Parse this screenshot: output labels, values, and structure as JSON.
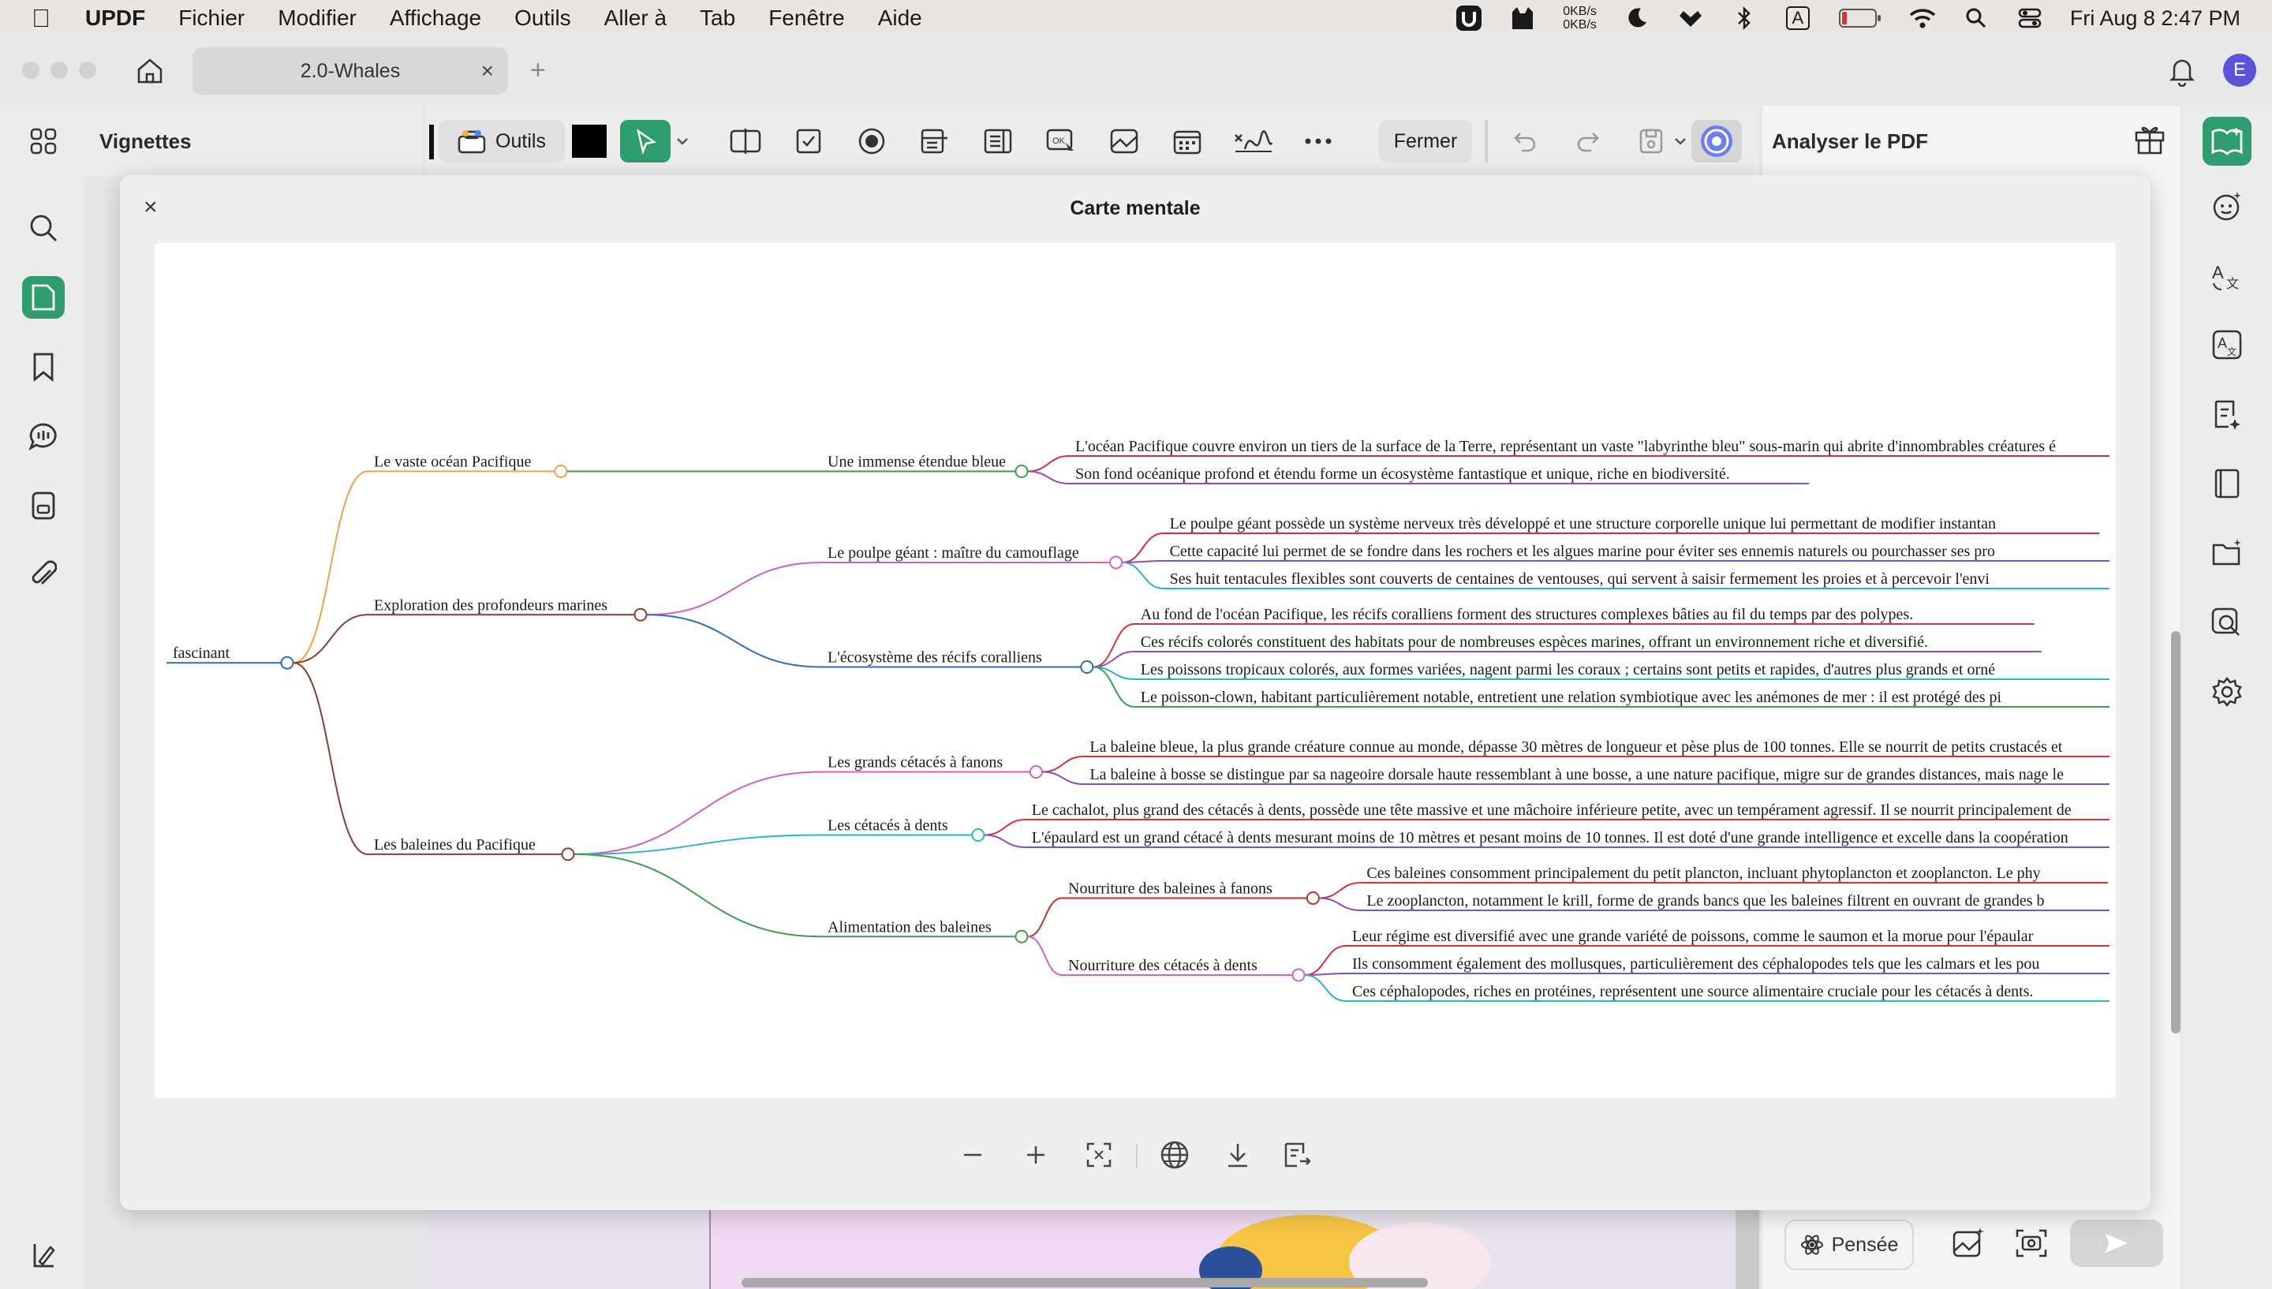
{
  "menubar": {
    "app_name": "UPDF",
    "items": [
      "Fichier",
      "Modifier",
      "Affichage",
      "Outils",
      "Aller à",
      "Tab",
      "Fenêtre",
      "Aide"
    ],
    "net_up": "0KB/s",
    "net_down": "0KB/s",
    "keyboard": "A",
    "datetime": "Fri Aug 8  2:47 PM"
  },
  "window": {
    "tab_title": "2.0-Whales"
  },
  "left_panel": {
    "title": "Vignettes"
  },
  "toolbar": {
    "tools_label": "Outils",
    "close_label": "Fermer"
  },
  "right_panel": {
    "title": "Analyser le PDF",
    "pensee_label": "Pensée",
    "avatar_letter": "E"
  },
  "modal": {
    "title": "Carte mentale"
  },
  "mindmap": {
    "root": "fascinant",
    "branches": [
      {
        "label": "Le vaste océan Pacifique",
        "color": "#f0a04b",
        "children": [
          {
            "label": "Une immense étendue bleue",
            "color": "#3d9e4c",
            "leaves": [
              "L'océan Pacifique couvre environ un tiers de la surface de la Terre, représentant un vaste \"labyrinthe bleu\" sous-marin qui abrite d'innombrables créatures é",
              "Son fond océanique profond et étendu forme un écosystème fantastique et unique, riche en biodiversité."
            ]
          }
        ]
      },
      {
        "label": "Exploration des profondeurs marines",
        "color": "#8a3d32",
        "children": [
          {
            "label": "Le poulpe géant : maître du camouflage",
            "color": "#d45fbf",
            "leaves": [
              "Le poulpe géant possède un système nerveux très développé et une structure corporelle unique lui permettant de modifier instantan",
              "Cette capacité lui permet de se fondre dans les rochers et les algues marine pour éviter ses ennemis naturels ou pourchasser ses pro",
              "Ses huit tentacules flexibles sont couverts de centaines de ventouses, qui servent à saisir fermement les proies et à percevoir l'envi"
            ]
          },
          {
            "label": "L'écosystème des récifs coralliens",
            "color": "#2c6fb8",
            "leaves": [
              "Au fond de l'océan Pacifique, les récifs coralliens forment des structures complexes bâties au fil du temps par des polypes.",
              "Ces récifs colorés constituent des habitats pour de nombreuses espèces marines, offrant un environnement riche et diversifié.",
              "Les poissons tropicaux colorés, aux formes variées, nagent parmi les coraux ; certains sont petits et rapides, d'autres plus grands et orné",
              "Le poisson-clown, habitant particulièrement notable, entretient une relation symbiotique avec les anémones de mer : il est protégé des pi"
            ]
          }
        ]
      },
      {
        "label": "Les baleines du Pacifique",
        "color": "#8a3d32",
        "children": [
          {
            "label": "Les grands cétacés à fanons",
            "color": "#d45fbf",
            "leaves": [
              "La baleine bleue, la plus grande créature connue au monde, dépasse 30 mètres de longueur et pèse plus de 100 tonnes. Elle se nourrit de petits crustacés et",
              "La baleine à bosse se distingue par sa nageoire dorsale haute ressemblant à une bosse, a une nature pacifique, migre sur de grandes distances, mais nage le"
            ]
          },
          {
            "label": "Les cétacés à dents",
            "color": "#2fb1c9",
            "leaves": [
              "Le cachalot, plus grand des cétacés à dents, possède une tête massive et une mâchoire inférieure petite, avec un tempérament agressif. Il se nourrit principalement de",
              "L'épaulard est un grand cétacé à dents mesurant moins de 10 mètres et pesant moins de 10 tonnes. Il est doté d'une grande intelligence et excelle dans la coopération"
            ]
          },
          {
            "label": "Alimentation des baleines",
            "color": "#3d9e4c",
            "children": [
              {
                "label": "Nourriture des baleines à fanons",
                "color": "#b8322c",
                "leaves": [
                  "Ces baleines consomment principalement du petit plancton, incluant phytoplancton et zooplancton. Le phy",
                  "Le zooplancton, notamment le krill, forme de grands bancs que les baleines filtrent en ouvrant de grandes b"
                ]
              },
              {
                "label": "Nourriture des cétacés à dents",
                "color": "#d45fbf",
                "leaves": [
                  "Leur régime est diversifié avec une grande variété de poissons, comme le saumon et la morue pour l'épaular",
                  "Ils consomment également des mollusques, particulièrement des céphalopodes tels que les calmars et les pou",
                  "Ces céphalopodes, riches en protéines, représentent une source alimentaire cruciale pour les cétacés à dents."
                ]
              }
            ]
          }
        ]
      }
    ]
  }
}
